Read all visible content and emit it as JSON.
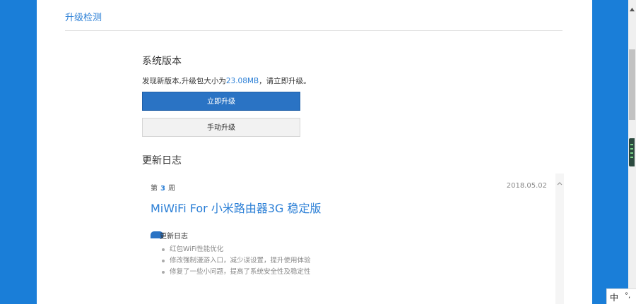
{
  "header": {
    "title": "升级检测"
  },
  "system": {
    "title": "系统版本",
    "message_prefix": "发现新版本,升级包大小为",
    "package_size": "23.08MB",
    "message_suffix": "，请立即升级。",
    "upgrade_now_label": "立即升级",
    "manual_upgrade_label": "手动升级"
  },
  "changelog": {
    "title": "更新日志",
    "week_prefix": "第",
    "week_number": "3",
    "week_suffix": "周",
    "date": "2018.05.02",
    "release_title": "MiWiFi For 小米路由器3G 稳定版",
    "section_label": "更新日志",
    "items": [
      "红包WiFi性能优化",
      "修改强制漫游入口，减少误设置，提升使用体验",
      "修复了一些小问题，提高了系统安全性及稳定性"
    ]
  },
  "ime": {
    "mode": "中",
    "punct": "°,"
  },
  "colors": {
    "accent": "#2b7fd6",
    "side_bg": "#1a7ed8",
    "button_primary": "#2a73c4"
  }
}
